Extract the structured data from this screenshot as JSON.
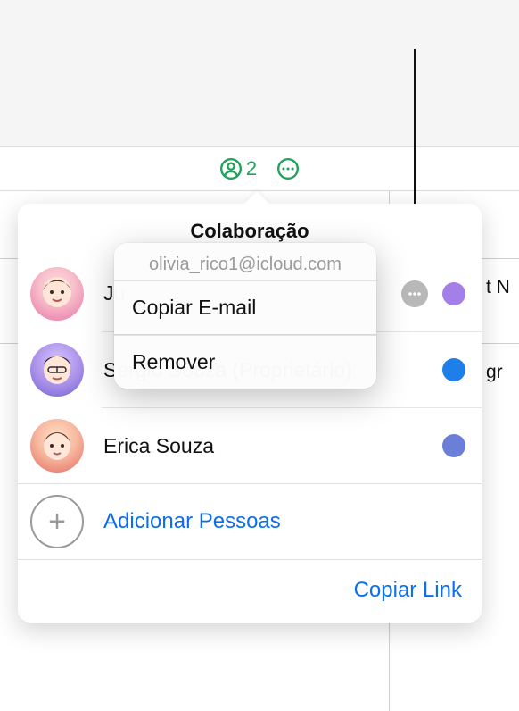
{
  "toolbar": {
    "collab_count": "2"
  },
  "popover": {
    "title": "Colaboração",
    "participants": [
      {
        "name": "Ju",
        "avatar_kind": "pink",
        "dot": "dPurple"
      },
      {
        "name": "Sergio Souza (Proprietário)",
        "avatar_kind": "purple",
        "dot": "dBlue"
      },
      {
        "name": "Erica Souza",
        "avatar_kind": "red",
        "dot": "dSlate"
      }
    ],
    "add_label": "Adicionar Pessoas",
    "copy_link_label": "Copiar Link"
  },
  "context_menu": {
    "email": "olivia_rico1@icloud.com",
    "copy_email_label": "Copiar E-mail",
    "remove_label": "Remover"
  },
  "background": {
    "cell_right_1": "t N",
    "cell_right_2": "gr"
  }
}
